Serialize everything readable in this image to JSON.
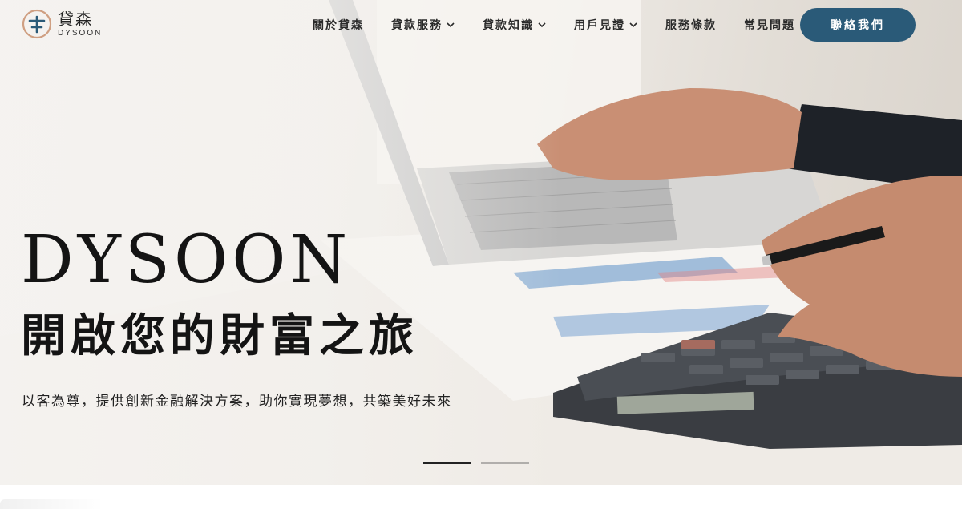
{
  "header": {
    "logo_cn": "貸森",
    "logo_en": "DYSOON",
    "nav": [
      {
        "label": "關於貸森",
        "has_dropdown": false
      },
      {
        "label": "貸款服務",
        "has_dropdown": true
      },
      {
        "label": "貸款知識",
        "has_dropdown": true
      },
      {
        "label": "用戶見證",
        "has_dropdown": true
      },
      {
        "label": "服務條款",
        "has_dropdown": false
      },
      {
        "label": "常見問題",
        "has_dropdown": false
      }
    ],
    "contact_label": "聯絡我們"
  },
  "hero": {
    "brand": "DYSOON",
    "headline": "開啟您的財富之旅",
    "subline": "以客為尊，提供創新金融解決方案，助你實現夢想，共築美好未來",
    "slides_total": 2,
    "active_slide": 1
  },
  "colors": {
    "accent": "#2a5a78",
    "text": "#141414"
  },
  "icons": {
    "logo": "dysoon-logo-mark",
    "dropdown": "chevron-down-icon"
  }
}
